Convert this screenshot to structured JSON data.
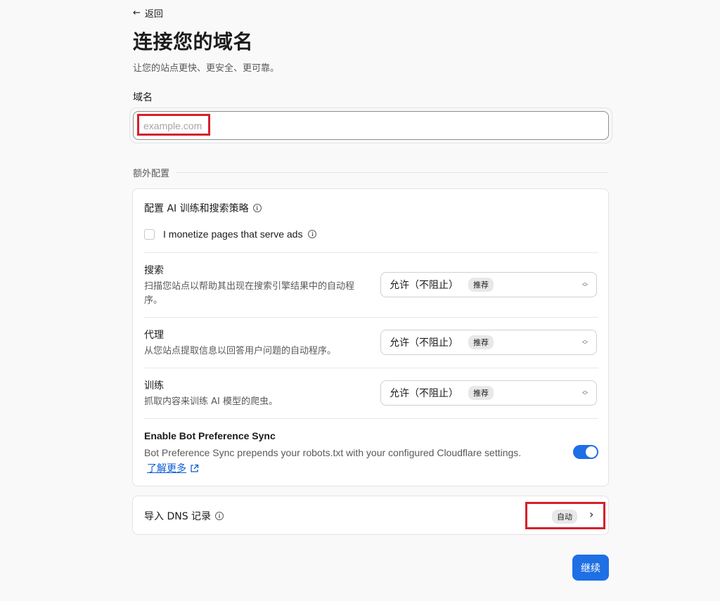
{
  "nav": {
    "back_label": "返回"
  },
  "header": {
    "title": "连接您的域名",
    "subtitle": "让您的站点更快、更安全、更可靠。"
  },
  "domain": {
    "label": "域名",
    "placeholder": "example.com",
    "value": ""
  },
  "extra": {
    "heading": "额外配置",
    "ai_policy": {
      "title": "配置 AI 训练和搜索策略",
      "monetize_label": "I monetize pages that serve ads",
      "monetize_checked": false,
      "rows": [
        {
          "name": "搜索",
          "description": "扫描您站点以帮助其出现在搜索引擎结果中的自动程序。",
          "selected": "允许（不阻止）",
          "badge": "推荐"
        },
        {
          "name": "代理",
          "description": "从您站点提取信息以回答用户问题的自动程序。",
          "selected": "允许（不阻止）",
          "badge": "推荐"
        },
        {
          "name": "训练",
          "description": "抓取内容来训练 AI 模型的爬虫。",
          "selected": "允许（不阻止）",
          "badge": "推荐"
        }
      ],
      "sync": {
        "title": "Enable Bot Preference Sync",
        "description": "Bot Preference Sync prepends your robots.txt with your configured Cloudflare settings.",
        "learn_more": "了解更多",
        "enabled": true
      }
    },
    "dns": {
      "title": "导入 DNS 记录",
      "badge": "自动"
    }
  },
  "actions": {
    "continue_label": "继续"
  },
  "colors": {
    "accent": "#1f6fe5",
    "highlight": "#d6202a",
    "link": "#0b5cd6"
  },
  "icons": {
    "back": "arrow-left-icon",
    "info": "info-icon",
    "select": "chevron-up-down-icon",
    "external": "external-link-icon",
    "next": "chevron-right-icon"
  }
}
